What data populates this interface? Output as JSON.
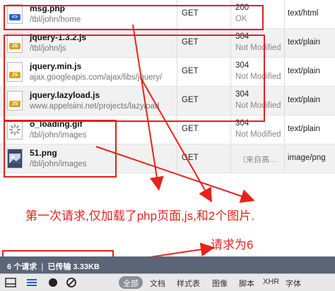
{
  "rows": [
    {
      "name": "msg.php",
      "path": "/tbl/john/home",
      "method": "GET",
      "status": "200",
      "status_text": "OK",
      "type": "text/html",
      "icon": "php-file-icon",
      "badge": "<>"
    },
    {
      "name": "jquery-1.3.2.js",
      "path": "/tbl/john/js",
      "method": "GET",
      "status": "304",
      "status_text": "Not Modified",
      "type": "text/plain",
      "icon": "js-file-icon",
      "badge": "JS"
    },
    {
      "name": "jquery.min.js",
      "path": "ajax.googleapis.com/ajax/libs/jquery/",
      "method": "GET",
      "status": "304",
      "status_text": "Not Modified",
      "type": "text/plain",
      "icon": "js-file-icon",
      "badge": "JS"
    },
    {
      "name": "jquery.lazyload.js",
      "path": "www.appelsiini.net/projects/lazyload",
      "method": "GET",
      "status": "304",
      "status_text": "Not Modified",
      "type": "text/plain",
      "icon": "js-file-icon",
      "badge": "JS"
    },
    {
      "name": "o_loading.gif",
      "path": "/tbl/john/images",
      "method": "GET",
      "status": "304",
      "status_text": "Not Modified",
      "type": "text/plain",
      "icon": "gif-file-icon",
      "badge": ""
    },
    {
      "name": "51.png",
      "path": "/tbl/john/images",
      "method": "GET",
      "status": "",
      "status_text": "（来自高…",
      "type": "image/png",
      "icon": "png-file-icon",
      "badge": ""
    }
  ],
  "annotations": {
    "main": "第一次请求,仅加载了php页面,js,和2个图片.",
    "count": "请求为6"
  },
  "footer": {
    "summary": "6 个请求  ❘  已传输 3.33KB"
  },
  "toolbar": {
    "all": "全部",
    "tabs": [
      "文档",
      "样式表",
      "图像",
      "脚本",
      "XHR",
      "字体"
    ]
  },
  "colors": {
    "annotation_red": "#e8221c",
    "footer_bg": "#5a6577"
  }
}
